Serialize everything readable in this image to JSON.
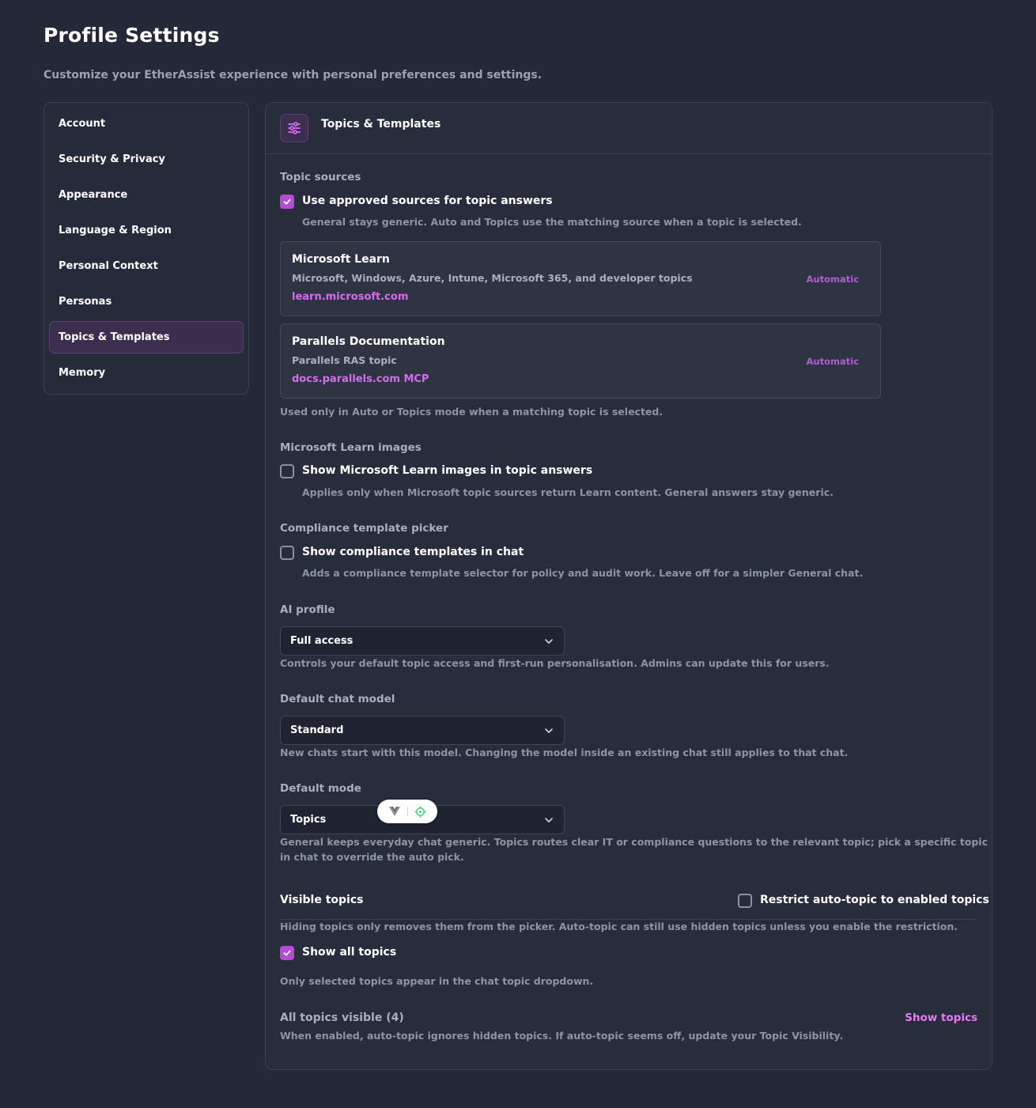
{
  "page": {
    "title": "Profile Settings",
    "subtitle": "Customize your EtherAssist experience with personal preferences and settings."
  },
  "sidebar": {
    "items": [
      {
        "label": "Account"
      },
      {
        "label": "Security & Privacy"
      },
      {
        "label": "Appearance"
      },
      {
        "label": "Language & Region"
      },
      {
        "label": "Personal Context"
      },
      {
        "label": "Personas"
      },
      {
        "label": "Topics & Templates",
        "active": true
      },
      {
        "label": "Memory"
      }
    ]
  },
  "panel": {
    "title": "Topics & Templates",
    "icon": "sliders-icon",
    "topic_sources": {
      "label": "Topic sources",
      "option_label": "Use approved sources for topic answers",
      "checked": true,
      "help": "General stays generic. Auto and Topics use the matching source when a topic is selected.",
      "sources": [
        {
          "name": "Microsoft Learn",
          "desc": "Microsoft, Windows, Azure, Intune, Microsoft 365, and developer topics",
          "link": "learn.microsoft.com",
          "badge": "Automatic"
        },
        {
          "name": "Parallels Documentation",
          "desc": "Parallels RAS topic",
          "link": "docs.parallels.com MCP",
          "badge": "Automatic"
        }
      ],
      "footer": "Used only in Auto or Topics mode when a matching topic is selected."
    },
    "ms_images": {
      "label": "Microsoft Learn images",
      "option_label": "Show Microsoft Learn images in topic answers",
      "checked": false,
      "help": "Applies only when Microsoft topic sources return Learn content. General answers stay generic."
    },
    "compliance": {
      "label": "Compliance template picker",
      "option_label": "Show compliance templates in chat",
      "checked": false,
      "help": "Adds a compliance template selector for policy and audit work. Leave off for a simpler General chat."
    },
    "ai_profile": {
      "label": "AI profile",
      "value": "Full access",
      "help": "Controls your default topic access and first-run personalisation. Admins can update this for users."
    },
    "chat_model": {
      "label": "Default chat model",
      "value": "Standard",
      "help": "New chats start with this model. Changing the model inside an existing chat still applies to that chat."
    },
    "default_mode": {
      "label": "Default mode",
      "value": "Topics",
      "help_line1": "General keeps everyday chat generic. Topics routes clear IT or compliance questions to the relevant topic; pick a specific topic",
      "help_line2": "in chat to override the auto pick."
    },
    "visible_topics": {
      "label": "Visible topics",
      "restrict_label": "Restrict auto-topic to enabled topics",
      "restrict_checked": false,
      "help": "Hiding topics only removes them from the picker. Auto-topic can still use hidden topics unless you enable the restriction.",
      "show_all_label": "Show all topics",
      "show_all_checked": true,
      "show_all_help": "Only selected topics appear in the chat topic dropdown.",
      "summary": "All topics visible (4)",
      "summary_help": "When enabled, auto-topic ignores hidden topics. If auto-topic seems off, update your Topic Visibility.",
      "show_link": "Show topics"
    }
  },
  "colors": {
    "background": "#232936",
    "accent": "#b14fd0",
    "link": "#e879f9"
  }
}
